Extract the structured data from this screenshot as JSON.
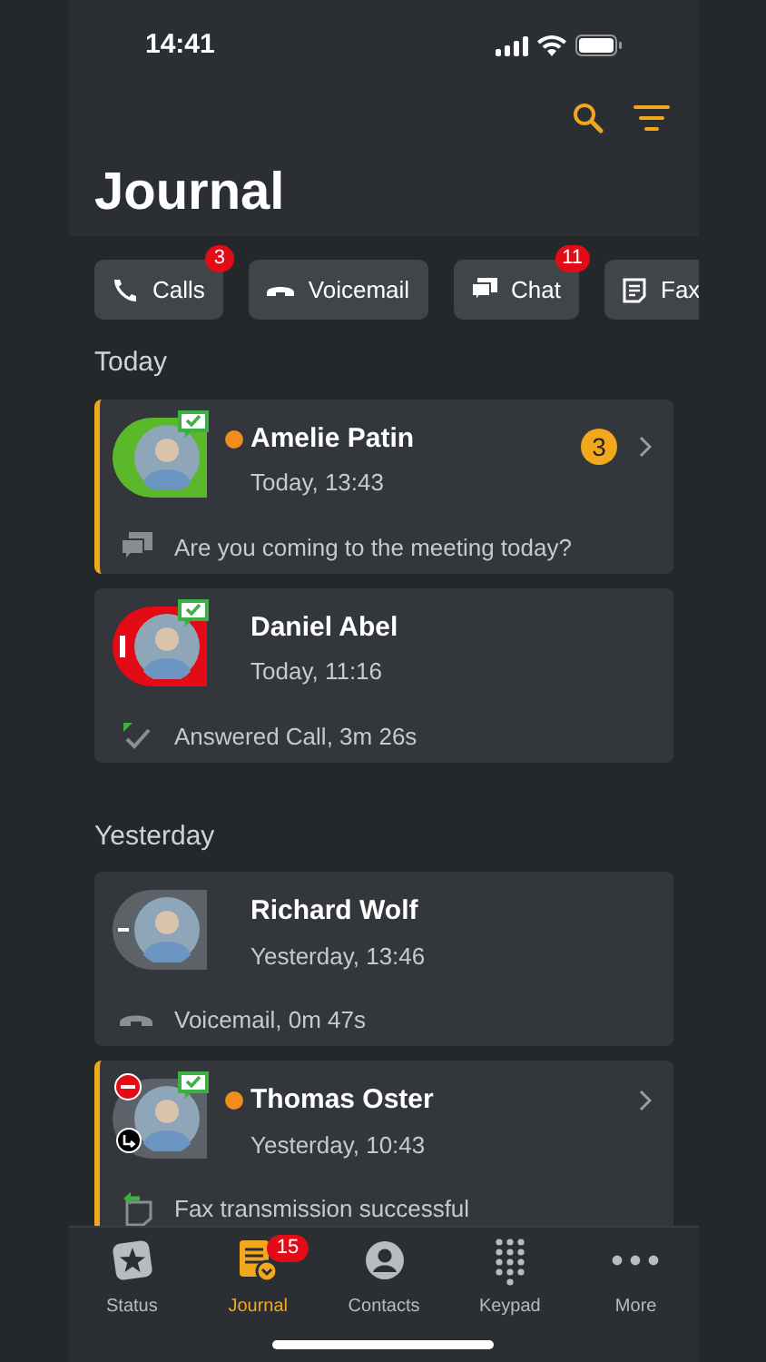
{
  "status_bar": {
    "time": "14:41"
  },
  "title": "Journal",
  "filters": [
    {
      "label": "Calls",
      "kind": "calls",
      "badge": "3"
    },
    {
      "label": "Voicemail",
      "kind": "voicemail"
    },
    {
      "label": "Chat",
      "kind": "chat",
      "badge": "11"
    },
    {
      "label": "Fax",
      "kind": "fax"
    }
  ],
  "sections": [
    {
      "heading": "Today",
      "entries": [
        {
          "name": "Amelie Patin",
          "time": "Today, 13:43",
          "unread": true,
          "highlighted": true,
          "count": "3",
          "chevron": true,
          "avatar": {
            "kind": "available"
          },
          "chat_ready": true,
          "forwarding": false,
          "detail": {
            "kind": "chat",
            "text": "Are you coming to the meeting today?"
          }
        },
        {
          "name": "Daniel Abel",
          "time": "Today, 11:16",
          "unread": false,
          "highlighted": false,
          "chevron": false,
          "avatar": {
            "kind": "busy"
          },
          "chat_ready": true,
          "forwarding": false,
          "detail": {
            "kind": "answered",
            "text": "Answered Call, 3m 26s"
          }
        }
      ]
    },
    {
      "heading": "Yesterday",
      "entries": [
        {
          "name": "Richard Wolf",
          "time": "Yesterday, 13:46",
          "unread": false,
          "highlighted": false,
          "chevron": false,
          "avatar": {
            "kind": "offline"
          },
          "chat_ready": false,
          "forwarding": false,
          "detail": {
            "kind": "voicemail",
            "text": "Voicemail, 0m 47s"
          }
        },
        {
          "name": "Thomas Oster",
          "time": "Yesterday, 10:43",
          "unread": true,
          "highlighted": true,
          "chevron": true,
          "avatar": {
            "kind": "dnd"
          },
          "chat_ready": true,
          "forwarding": true,
          "detail": {
            "kind": "fax",
            "text": "Fax transmission successful"
          }
        }
      ]
    }
  ],
  "tab_bar": [
    {
      "label": "Status",
      "kind": "status",
      "selected": false
    },
    {
      "label": "Journal",
      "kind": "journal",
      "selected": true,
      "badge": "15"
    },
    {
      "label": "Contacts",
      "kind": "contacts",
      "selected": false
    },
    {
      "label": "Keypad",
      "kind": "keypad",
      "selected": false
    },
    {
      "label": "More",
      "kind": "more",
      "selected": false
    }
  ]
}
